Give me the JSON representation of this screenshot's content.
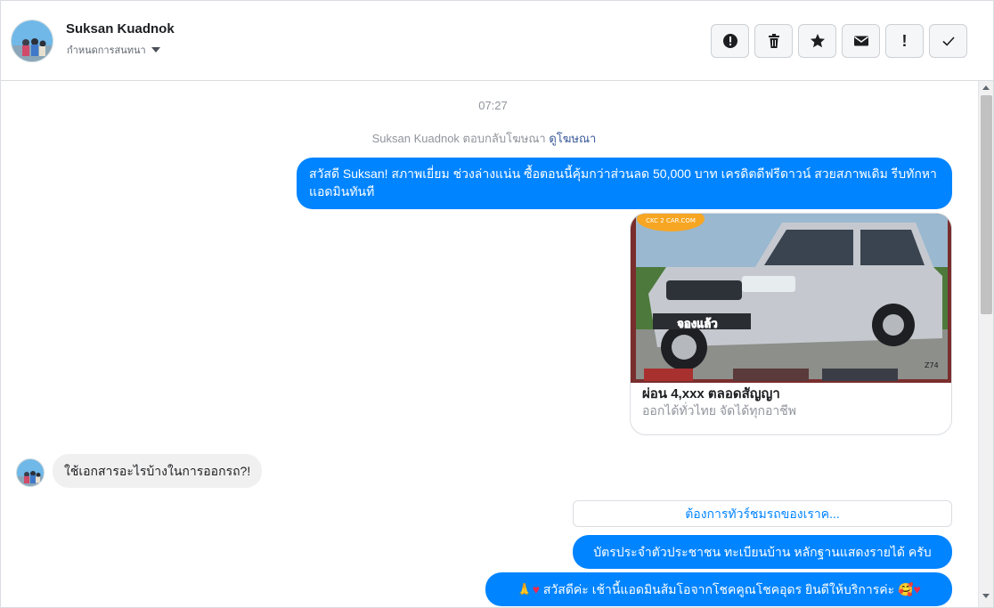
{
  "contact": {
    "name": "Suksan Kuadnok",
    "assign_label": "กำหนดการสนทนา"
  },
  "toolbar": {
    "icons": [
      "alert-circle-icon",
      "trash-icon",
      "star-icon",
      "envelope-icon",
      "exclamation-icon",
      "check-icon"
    ],
    "exclamation_glyph": "!"
  },
  "thread": {
    "timestamp": "07:27",
    "ad_note": "Suksan Kuadnok ตอบกลับโฆษณา",
    "ad_link": "ดูโฆษณา",
    "messages": [
      {
        "from": "page",
        "text": "สวัสดี Suksan!  สภาพเยี่ยม ช่วงล่างแน่น  ซื้อตอนนี้คุ้มกว่าส่วนลด 50,000 บาท เครดิตดีฟรีดาวน์  สวยสภาพเดิม รีบทักหาแอดมินทันที"
      },
      {
        "from": "page",
        "type": "card",
        "card_title": "ผ่อน 4,xxx ตลอดสัญญา",
        "card_subtitle": "ออกได้ทั่วไทย จัดได้ทุกอาชีพ",
        "image_badge": "CKC 2 CAR.COM",
        "image_sticker": "จองแล้ว",
        "image_code": "Z74"
      },
      {
        "from": "user",
        "text": "ใช้เอกสารอะไรบ้างในการออกรถ?!"
      },
      {
        "from": "page",
        "type": "quick_reply",
        "text": "ต้องการทัวร์ชมรถของเราค..."
      },
      {
        "from": "page",
        "text": "บัตรประจำตัวประชาชน ทะเบียนบ้าน หลักฐานแสดงรายได้ ครับ"
      },
      {
        "from": "page",
        "text_prefix": "🙏",
        "text": " สวัสดีค่ะ เช้านี้แอดมินส้มโอจากโชคคูณโชคอุดร ยินดีให้บริการค่ะ  🥰"
      }
    ]
  },
  "colors": {
    "accent": "#0084ff",
    "incoming_bubble": "#f1f0f0",
    "link": "#385898",
    "muted": "#90949c"
  }
}
